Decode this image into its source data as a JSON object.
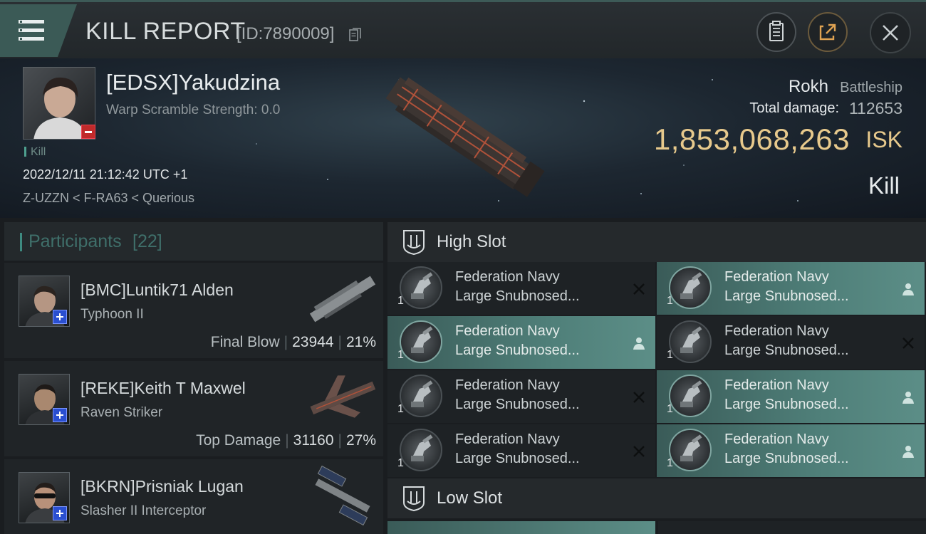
{
  "topbar": {
    "title": "KILL REPORT",
    "report_id": "[ID:7890009]",
    "icons": [
      "menu-icon",
      "copy-icon",
      "clipboard-icon",
      "share-icon",
      "close-icon"
    ]
  },
  "victim": {
    "name": "[EDSX]Yakudzina",
    "warp_scramble": "Warp Scramble Strength: 0.0",
    "tag": "Kill",
    "datetime": "2022/12/11 21:12:42 UTC +1",
    "location": "Z-UZZN < F-RA63 < Querious",
    "ship_name": "Rokh",
    "ship_class": "Battleship",
    "total_damage_label": "Total damage:",
    "total_damage": "112653",
    "isk_value": "1,853,068,263",
    "isk_unit": "ISK",
    "result": "Kill"
  },
  "participants": {
    "title": "Participants",
    "count": "[22]",
    "rows": [
      {
        "name": "[BMC]Luntik71 Alden",
        "ship": "Typhoon II",
        "role": "Final Blow",
        "damage": "23944",
        "percent": "21%"
      },
      {
        "name": "[REKE]Keith T Maxwel",
        "ship": "Raven Striker",
        "role": "Top Damage",
        "damage": "31160",
        "percent": "27%"
      },
      {
        "name": "[BKRN]Prisniak Lugan",
        "ship": "Slasher II Interceptor",
        "role": "",
        "damage": "",
        "percent": ""
      }
    ]
  },
  "slots": {
    "high_slot_label": "High Slot",
    "low_slot_label": "Low Slot",
    "modules": [
      {
        "qty": "1",
        "name1": "Federation Navy",
        "name2": "Large Snubnosed...",
        "status": "destroyed",
        "status_icon": "x-icon",
        "active": false
      },
      {
        "qty": "1",
        "name1": "Federation Navy",
        "name2": "Large Snubnosed...",
        "status": "dropped",
        "status_icon": "person-icon",
        "active": true
      },
      {
        "qty": "1",
        "name1": "Federation Navy",
        "name2": "Large Snubnosed...",
        "status": "dropped",
        "status_icon": "person-icon",
        "active": true
      },
      {
        "qty": "1",
        "name1": "Federation Navy",
        "name2": "Large Snubnosed...",
        "status": "destroyed",
        "status_icon": "x-icon",
        "active": false
      },
      {
        "qty": "1",
        "name1": "Federation Navy",
        "name2": "Large Snubnosed...",
        "status": "destroyed",
        "status_icon": "x-icon",
        "active": false
      },
      {
        "qty": "1",
        "name1": "Federation Navy",
        "name2": "Large Snubnosed...",
        "status": "dropped",
        "status_icon": "person-icon",
        "active": true
      },
      {
        "qty": "1",
        "name1": "Federation Navy",
        "name2": "Large Snubnosed...",
        "status": "destroyed",
        "status_icon": "x-icon",
        "active": false
      },
      {
        "qty": "1",
        "name1": "Federation Navy",
        "name2": "Large Snubnosed...",
        "status": "dropped",
        "status_icon": "person-icon",
        "active": true
      }
    ]
  },
  "colors": {
    "accent_teal": "#4f7f79",
    "isk_gold": "#e7c98c",
    "badge_red": "#c02a2a",
    "badge_blue": "#2a4fd0"
  }
}
